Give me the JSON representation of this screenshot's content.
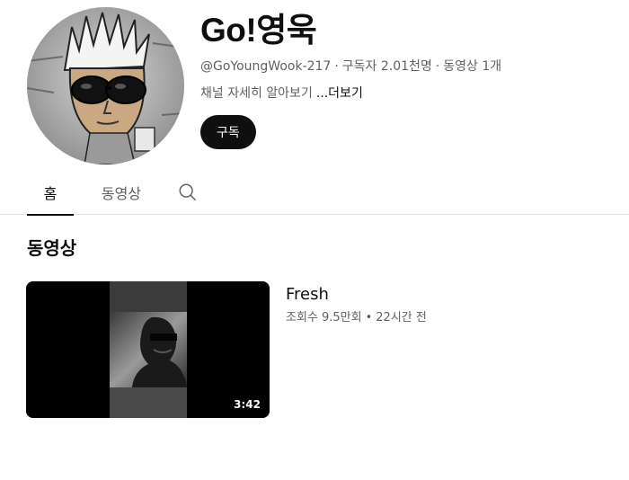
{
  "channel": {
    "name": "Go!영욱",
    "handle": "@GoYoungWook-217",
    "subscribers": "구독자 2.01천명",
    "video_count": "동영상 1개",
    "description": "채널 자세히 알아보기",
    "more_label": "...더보기",
    "subscribe_label": "구독"
  },
  "tabs": [
    {
      "label": "홈",
      "active": true
    },
    {
      "label": "동영상",
      "active": false
    }
  ],
  "search_icon": "search-icon",
  "section": {
    "title": "동영상",
    "videos": [
      {
        "title": "Fresh",
        "views": "조회수 9.5만회",
        "age": "22시간 전",
        "duration": "3:42"
      }
    ]
  },
  "colors": {
    "primary_text": "#0f0f0f",
    "secondary_text": "#606060",
    "subscribe_bg": "#0f0f0f",
    "divider": "#e5e5e5"
  }
}
